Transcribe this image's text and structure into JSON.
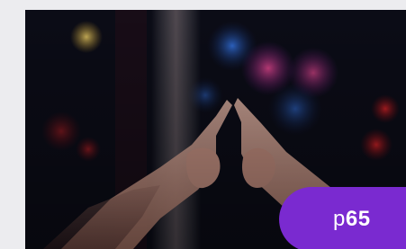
{
  "image": {
    "description": "",
    "colors": {
      "background": "#ececef",
      "badge": "#7a2ad0"
    }
  },
  "badge": {
    "prefix": "p",
    "number": "65"
  }
}
